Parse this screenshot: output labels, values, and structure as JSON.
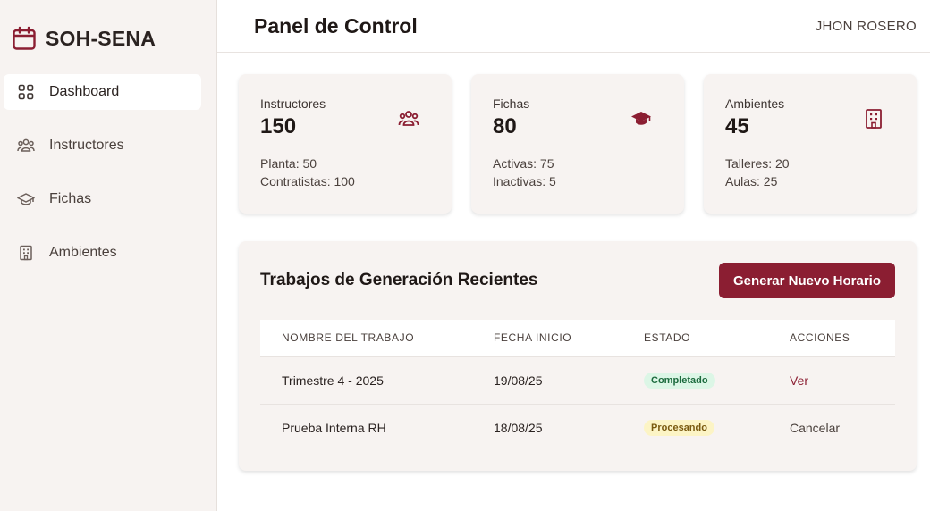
{
  "brand": {
    "name": "SOH-SENA",
    "logo_icon": "calendar-icon"
  },
  "sidebar": {
    "items": [
      {
        "label": "Dashboard",
        "icon": "grid-icon",
        "active": true
      },
      {
        "label": "Instructores",
        "icon": "users-icon",
        "active": false
      },
      {
        "label": "Fichas",
        "icon": "graduation-cap-icon",
        "active": false
      },
      {
        "label": "Ambientes",
        "icon": "building-icon",
        "active": false
      }
    ]
  },
  "header": {
    "title": "Panel de Control",
    "user": "JHON ROSERO"
  },
  "cards": [
    {
      "label": "Instructores",
      "value": "150",
      "line1": "Planta: 50",
      "line2": "Contratistas: 100",
      "icon": "users-icon"
    },
    {
      "label": "Fichas",
      "value": "80",
      "line1": "Activas: 75",
      "line2": "Inactivas: 5",
      "icon": "graduation-cap-icon"
    },
    {
      "label": "Ambientes",
      "value": "45",
      "line1": "Talleres: 20",
      "line2": "Aulas: 25",
      "icon": "building-icon"
    }
  ],
  "jobs": {
    "title": "Trabajos de Generación Recientes",
    "button_label": "Generar Nuevo Horario",
    "columns": [
      "NOMBRE DEL TRABAJO",
      "FECHA INICIO",
      "ESTADO",
      "ACCIONES"
    ],
    "rows": [
      {
        "name": "Trimestre 4 - 2025",
        "date": "19/08/25",
        "status": "Completado",
        "action": "Ver"
      },
      {
        "name": "Prueba Interna RH",
        "date": "18/08/25",
        "status": "Procesando",
        "action": "Cancelar"
      }
    ]
  },
  "colors": {
    "accent": "#8b1e32",
    "sidebar_bg": "#f7f3f1",
    "success_bg": "#dcf6e6",
    "warning_bg": "#fcf4c5"
  }
}
